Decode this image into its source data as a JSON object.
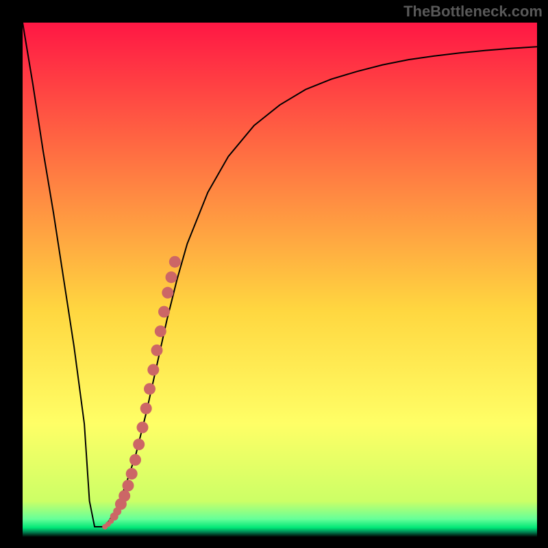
{
  "watermark": "TheBottleneck.com",
  "colors": {
    "top": "#ff1744",
    "mid": "#ffd740",
    "green": "#00e676",
    "black": "#000000",
    "curve": "#000000",
    "marker": "#cc6666"
  },
  "chart_data": {
    "type": "line",
    "title": "",
    "xlabel": "",
    "ylabel": "",
    "xlim": [
      0,
      100
    ],
    "ylim": [
      0,
      100
    ],
    "curve": {
      "x": [
        0,
        2,
        4,
        6,
        8,
        10,
        12,
        13,
        14,
        16,
        18,
        20,
        22,
        24,
        26,
        28,
        30,
        32,
        36,
        40,
        45,
        50,
        55,
        60,
        65,
        70,
        75,
        80,
        85,
        90,
        95,
        100
      ],
      "y": [
        100,
        88,
        75,
        63,
        50,
        37,
        22,
        7,
        2,
        2,
        5,
        10,
        16,
        24,
        33,
        42,
        50,
        57,
        67,
        74,
        80,
        84,
        87,
        89,
        90.5,
        91.8,
        92.8,
        93.5,
        94.1,
        94.6,
        95,
        95.3
      ]
    },
    "marker_segment": {
      "x": [
        16.0,
        16.6,
        17.2,
        17.8,
        18.4,
        19.1,
        19.8,
        20.5,
        21.2,
        21.9,
        22.6,
        23.3,
        24.0,
        24.7,
        25.4,
        26.1,
        26.8,
        27.5,
        28.2,
        28.9,
        29.6
      ],
      "y": [
        2.0,
        2.5,
        3.1,
        4.0,
        5.0,
        6.4,
        8.0,
        10.0,
        12.3,
        15.0,
        18.0,
        21.3,
        25.0,
        28.8,
        32.5,
        36.3,
        40.0,
        43.8,
        47.5,
        50.5,
        53.5
      ]
    }
  }
}
